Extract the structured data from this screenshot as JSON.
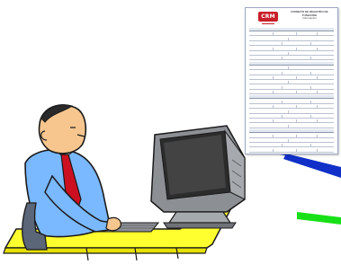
{
  "form": {
    "logo": "CRM",
    "title_line1": "FORMATO DE REGISTRO DE",
    "title_line2": "FUNGICIDE",
    "title_line3": "Información"
  },
  "colors": {
    "arrow_blue": "#1030c8",
    "arrow_green": "#18e018",
    "desk": "#ffff30",
    "shirt": "#7ab8ff",
    "tie": "#cc1020",
    "monitor": "#8c8f94"
  },
  "icons": [
    "worker-figure",
    "computer-monitor",
    "pointer-arrow"
  ]
}
